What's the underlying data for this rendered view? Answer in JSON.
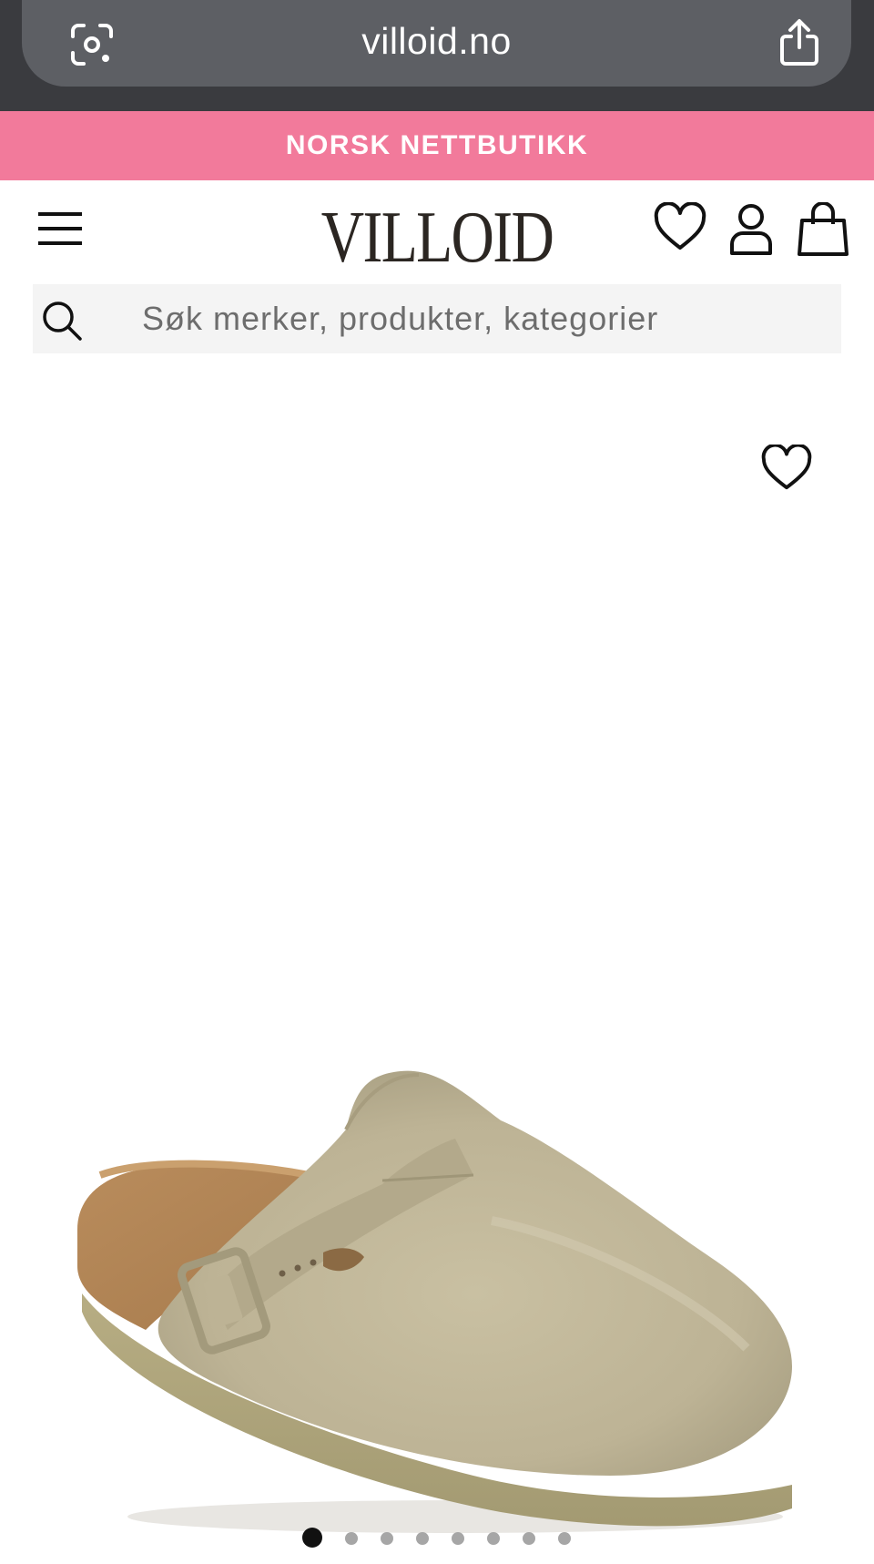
{
  "browser": {
    "domain": "villoid.no",
    "lens_icon": "camera-search-icon",
    "share_icon": "share-icon"
  },
  "banner": {
    "text": "NORSK NETTBUTIKK",
    "color": "#f27a9b"
  },
  "header": {
    "logo": "VILLOID",
    "menu_icon": "hamburger-icon",
    "favorites_icon": "heart-icon",
    "account_icon": "user-icon",
    "cart_icon": "shopping-bag-icon"
  },
  "search": {
    "placeholder": "Søk merker, produkter, kategorier",
    "value": "",
    "icon": "search-icon"
  },
  "product": {
    "wishlist_icon": "heart-icon",
    "image_description": "beige suede clog with buckle strap"
  },
  "carousel": {
    "total_slides": 8,
    "active_index": 0
  }
}
